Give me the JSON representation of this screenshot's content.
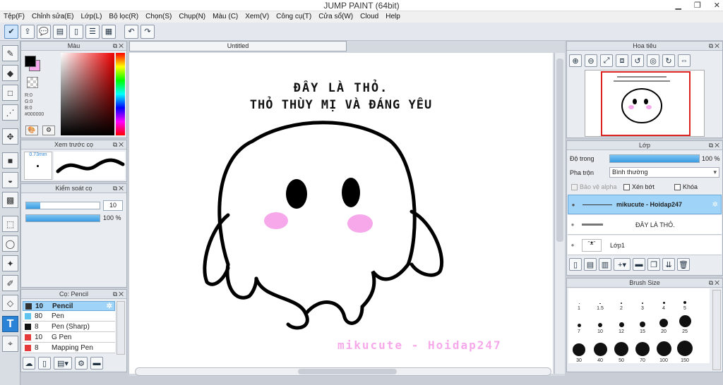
{
  "window": {
    "title": "JUMP PAINT (64bit)"
  },
  "menu": [
    "Tệp(F)",
    "Chỉnh sửa(E)",
    "Lớp(L)",
    "Bộ lọc(R)",
    "Chọn(S)",
    "Chụp(N)",
    "Màu (C)",
    "Xem(V)",
    "Công cụ(T)",
    "Cửa sổ(W)",
    "Cloud",
    "Help"
  ],
  "color_panel": {
    "title": "Màu",
    "r": "R:0",
    "g": "G:0",
    "b": "B:0",
    "hex": "#000000",
    "main_color": "#000000",
    "sub_color": "#f7a8ea"
  },
  "brush_preview": {
    "title": "Xem trước cọ",
    "size": "0.73mm"
  },
  "brush_control": {
    "title": "Kiểm soát cọ",
    "size_value": "10",
    "opacity_value": "100 %",
    "opacity_level": 1.0
  },
  "brush_list": {
    "title": "Cọ: Pencil",
    "items": [
      {
        "size": "10",
        "name": "Pencil",
        "color": "#333333",
        "selected": true
      },
      {
        "size": "80",
        "name": "Pen",
        "color": "#5ec3ef",
        "selected": false
      },
      {
        "size": "8",
        "name": "Pen (Sharp)",
        "color": "#111111",
        "selected": false
      },
      {
        "size": "10",
        "name": "G Pen",
        "color": "#e53a3a",
        "selected": false
      },
      {
        "size": "8",
        "name": "Mapping Pen",
        "color": "#e53a3a",
        "selected": false
      }
    ]
  },
  "canvas": {
    "tab": "Untitled",
    "text_line1": "ĐÂY LÀ THỎ.",
    "text_line2": "THỎ THÙY MỊ VÀ ĐÁNG YÊU",
    "signature": "mikucute - Hoidap247"
  },
  "navigator": {
    "title": "Hoa tiêu"
  },
  "layers": {
    "title": "Lớp",
    "opacity_label": "Độ trong",
    "opacity_value": "100 %",
    "opacity_level": 1.0,
    "blend_label": "Pha trộn",
    "blend_value": "Bình thường",
    "protect_alpha": "Bảo vệ alpha",
    "clipping": "Xén bớt",
    "lock": "Khóa",
    "items": [
      {
        "name": "mikucute - Hoidap247",
        "selected": true
      },
      {
        "name": "ĐÂY LÀ THỎ.",
        "selected": false
      },
      {
        "name": "Lớp1",
        "selected": false
      }
    ]
  },
  "brush_size": {
    "title": "Brush Size",
    "sizes": [
      "1",
      "1.5",
      "2",
      "3",
      "4",
      "5",
      "7",
      "10",
      "12",
      "15",
      "20",
      "25",
      "30",
      "40",
      "50",
      "70",
      "100",
      "150"
    ]
  }
}
